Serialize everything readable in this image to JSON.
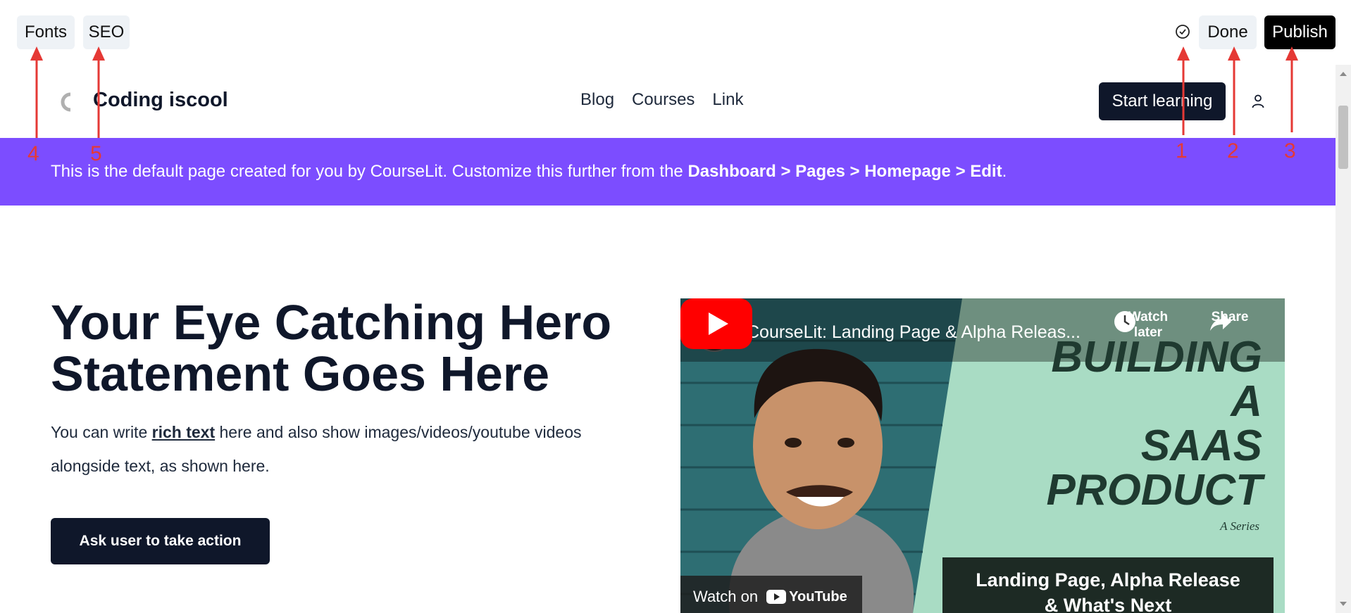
{
  "editor_toolbar": {
    "fonts_label": "Fonts",
    "seo_label": "SEO",
    "done_label": "Done",
    "publish_label": "Publish",
    "status_icon": "check-circle-icon"
  },
  "site": {
    "title": "Coding iscool",
    "nav": [
      "Blog",
      "Courses",
      "Link"
    ],
    "cta_label": "Start learning",
    "user_icon": "user-icon"
  },
  "banner": {
    "text_prefix": "This is the default page created for you by CourseLit. Customize this further from the ",
    "path": "Dashboard > Pages > Homepage > Edit",
    "text_suffix": "."
  },
  "hero": {
    "title": "Your Eye Catching Hero Statement Goes Here",
    "text_before": "You can write ",
    "text_link": "rich text",
    "text_after": " here and also show images/videos/youtube videos alongside text, as shown here.",
    "button_label": "Ask user to take action"
  },
  "video": {
    "channel_logo_text": "<🔥>",
    "title": "CourseLit: Landing Page & Alpha Releas...",
    "watch_later": "Watch later",
    "share": "Share",
    "thumb_line1": "BUILDING",
    "thumb_line2": "A",
    "thumb_line3": "SAAS",
    "thumb_line4": "PRODUCT",
    "thumb_series": "A Series",
    "thumb_sub1": "Landing Page, Alpha Release",
    "thumb_sub2": "& What's Next",
    "watch_on": "Watch on",
    "youtube": "YouTube"
  },
  "annotations": [
    "1",
    "2",
    "3",
    "4",
    "5"
  ],
  "colors": {
    "banner": "#7c4dff",
    "primary_dark": "#0f172a",
    "annotation_red": "#e53935",
    "toolbar_button": "#eef2f6"
  }
}
